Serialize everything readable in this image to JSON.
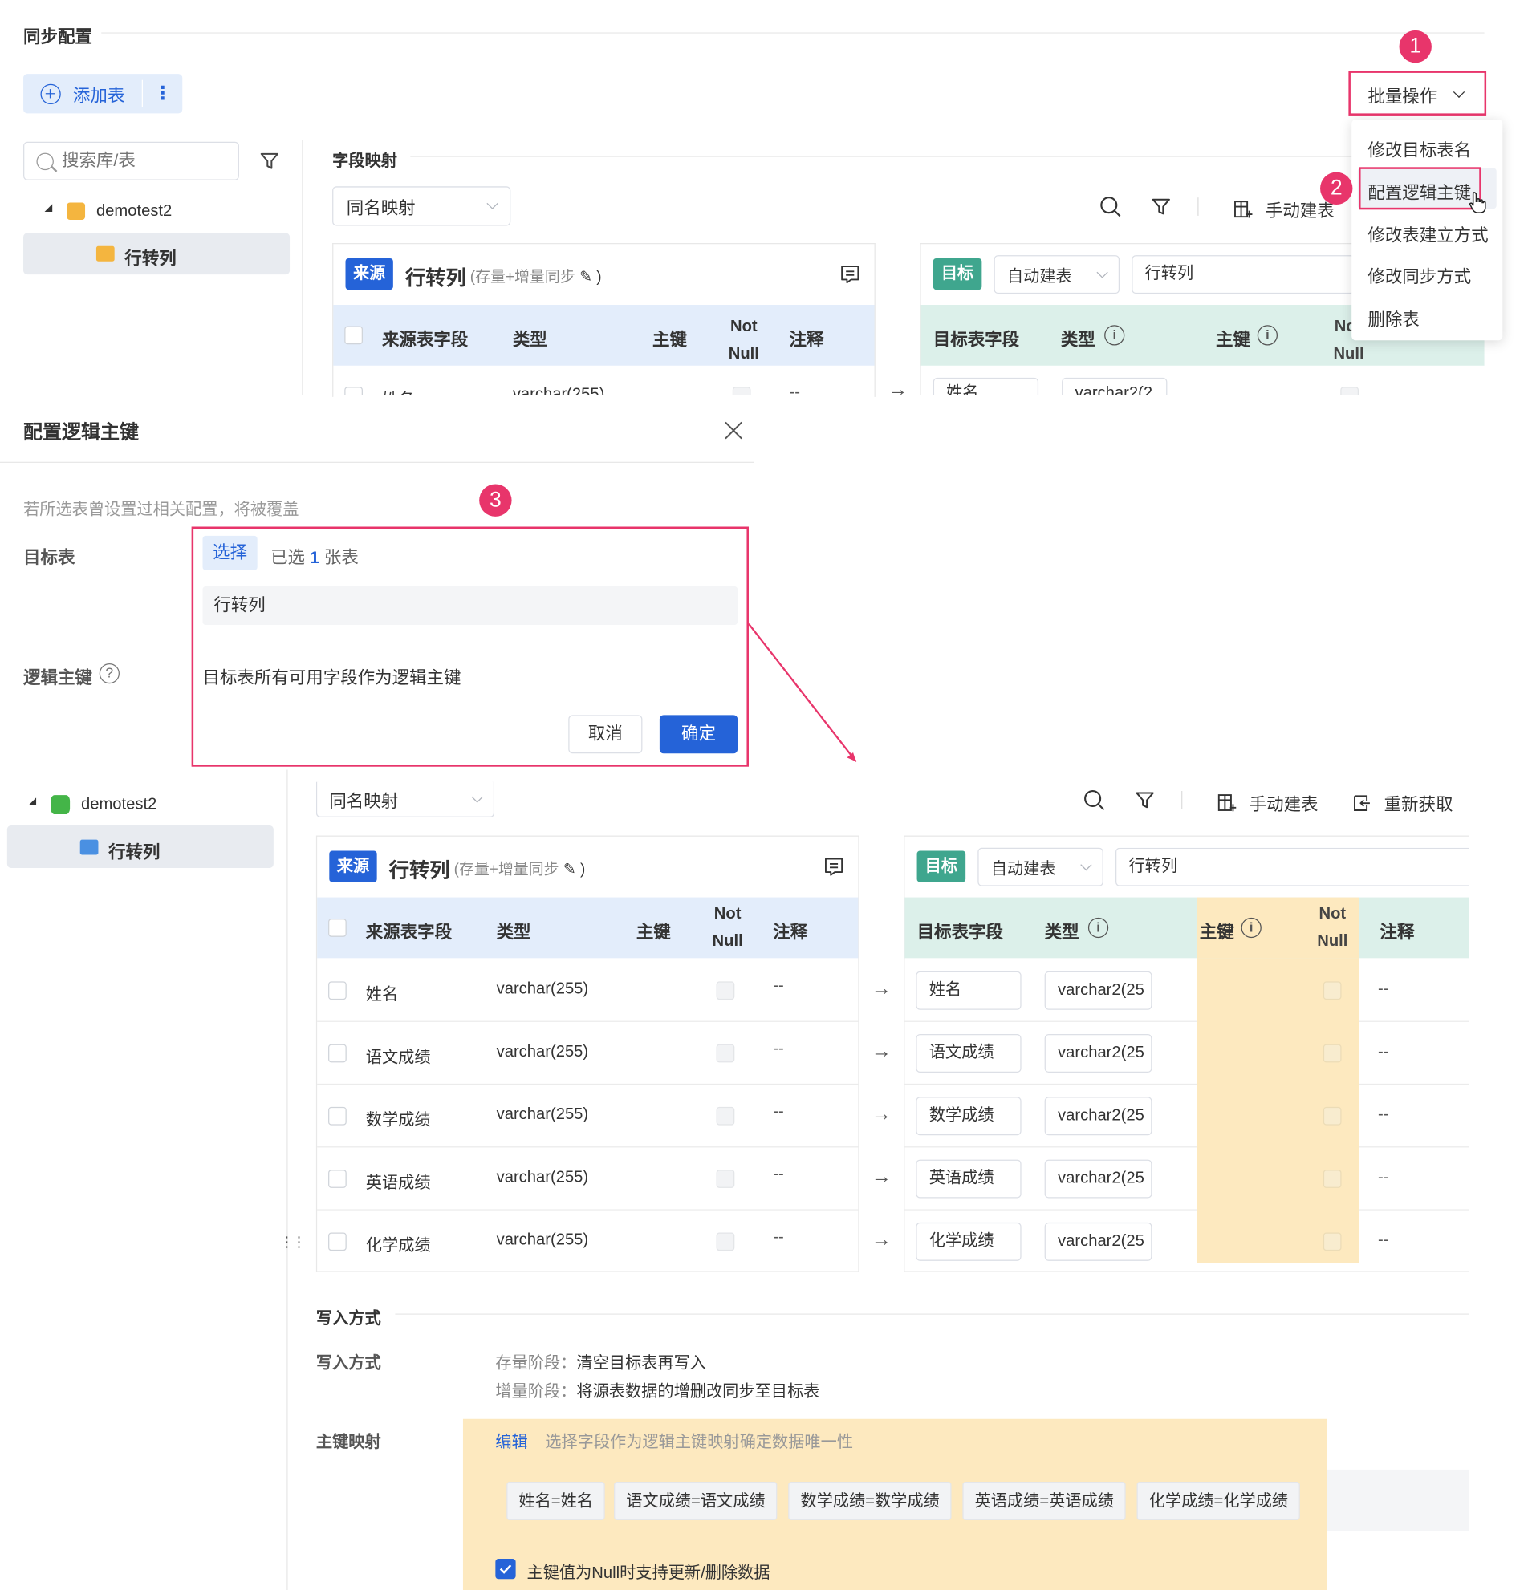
{
  "section_title": "同步配置",
  "add_table_label": "添加表",
  "bulk_ops": {
    "label": "批量操作",
    "menu": [
      "修改目标表名",
      "配置逻辑主键",
      "修改表建立方式",
      "修改同步方式",
      "删除表"
    ]
  },
  "search": {
    "placeholder": "搜索库/表"
  },
  "tree": {
    "db": "demotest2",
    "table": "行转列"
  },
  "field_mapping": {
    "title": "字段映射",
    "mode": "同名映射",
    "manual_build": "手动建表",
    "refetch": "重新获取"
  },
  "source_panel": {
    "badge": "来源",
    "table": "行转列",
    "sync_note": "(存量+增量同步",
    "sync_close": ")",
    "cols": {
      "field": "来源表字段",
      "type": "类型",
      "pk": "主键",
      "notnull_1": "Not",
      "notnull_2": "Null",
      "comment": "注释"
    }
  },
  "target_panel": {
    "badge": "目标",
    "build_mode": "自动建表",
    "table": "行转列",
    "cols": {
      "field": "目标表字段",
      "type": "类型",
      "pk": "主键",
      "notnull_1": "Not",
      "notnull_2": "Null",
      "notnull_cut": "No",
      "comment": "注释"
    }
  },
  "rows": [
    {
      "src": "姓名",
      "type": "varchar(255)",
      "comment": "--",
      "tgt": "姓名",
      "tgt_type": "varchar2(25",
      "tgt_comment": "--"
    },
    {
      "src": "语文成绩",
      "type": "varchar(255)",
      "comment": "--",
      "tgt": "语文成绩",
      "tgt_type": "varchar2(25",
      "tgt_comment": "--"
    },
    {
      "src": "数学成绩",
      "type": "varchar(255)",
      "comment": "--",
      "tgt": "数学成绩",
      "tgt_type": "varchar2(25",
      "tgt_comment": "--"
    },
    {
      "src": "英语成绩",
      "type": "varchar(255)",
      "comment": "--",
      "tgt": "英语成绩",
      "tgt_type": "varchar2(25",
      "tgt_comment": "--"
    },
    {
      "src": "化学成绩",
      "type": "varchar(255)",
      "comment": "--",
      "tgt": "化学成绩",
      "tgt_type": "varchar2(25",
      "tgt_comment": "--"
    }
  ],
  "partial_row": {
    "src": "姓名",
    "type": "varchar(255)",
    "comment": "--",
    "tgt": "姓名",
    "tgt_type": "varchar2(2"
  },
  "dialog": {
    "title": "配置逻辑主键",
    "warning": "若所选表曾设置过相关配置，将被覆盖",
    "target_label": "目标表",
    "select_btn": "选择",
    "selected_prefix": "已选",
    "selected_count": "1",
    "selected_suffix": "张表",
    "selected_table": "行转列",
    "pk_label": "逻辑主键",
    "pk_desc": "目标表所有可用字段作为逻辑主键",
    "cancel": "取消",
    "confirm": "确定"
  },
  "write": {
    "section_title": "写入方式",
    "label": "写入方式",
    "stock_label": "存量阶段：",
    "stock_value": "清空目标表再写入",
    "incr_label": "增量阶段：",
    "incr_value": "将源表数据的增删改同步至目标表",
    "pk_map_label": "主键映射",
    "edit": "编辑",
    "edit_hint": "选择字段作为逻辑主键映射确定数据唯一性",
    "tags": [
      "姓名=姓名",
      "语文成绩=语文成绩",
      "数学成绩=数学成绩",
      "英语成绩=英语成绩",
      "化学成绩=化学成绩"
    ],
    "null_update": "主键值为Null时支持更新/删除数据"
  },
  "callouts": [
    "1",
    "2",
    "3"
  ],
  "colors": {
    "accent": "#2563d8",
    "target": "#3fa68e",
    "highlight": "#fde9bf",
    "callout": "#e8356b"
  }
}
